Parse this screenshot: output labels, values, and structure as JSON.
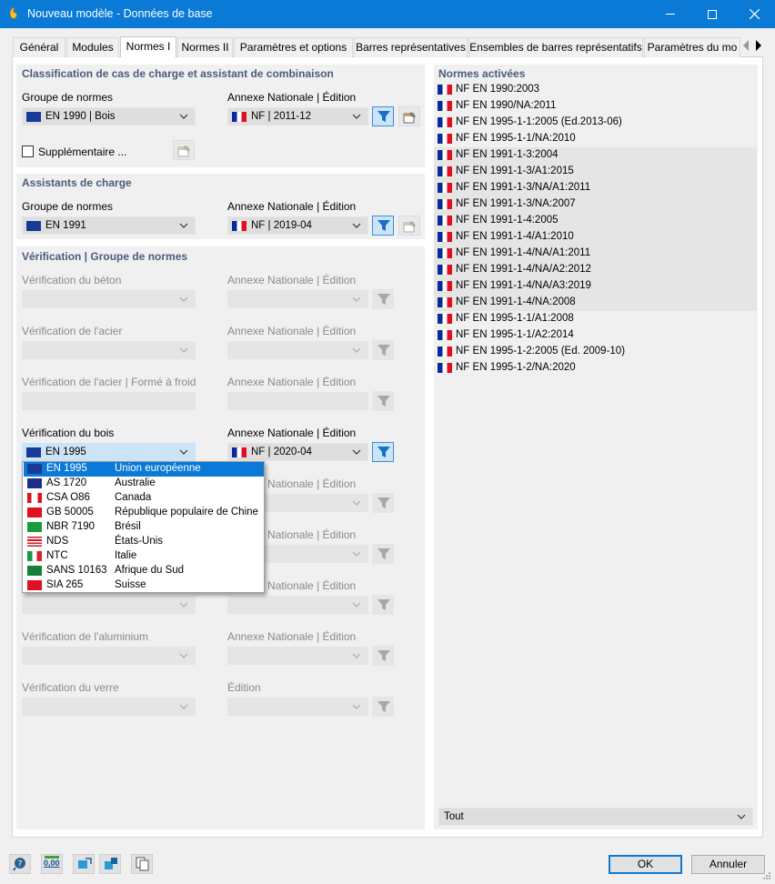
{
  "window": {
    "title": "Nouveau modèle - Données de base",
    "controls": {
      "minimize": "—",
      "maximize": "☐",
      "close": "✕"
    }
  },
  "tabs": [
    {
      "label": "Général"
    },
    {
      "label": "Modules"
    },
    {
      "label": "Normes I",
      "active": true
    },
    {
      "label": "Normes II"
    },
    {
      "label": "Paramètres et options"
    },
    {
      "label": "Barres représentatives"
    },
    {
      "label": "Ensembles de barres représentatifs"
    },
    {
      "label": "Paramètres du mo"
    }
  ],
  "classification": {
    "title": "Classification de cas de charge et assistant de combinaison",
    "group_label": "Groupe de normes",
    "group_value": "EN 1990 | Bois",
    "annex_label": "Annexe Nationale | Édition",
    "annex_value": "NF | 2011-12",
    "supplementary_label": "Supplémentaire ..."
  },
  "load_wizards": {
    "title": "Assistants de charge",
    "group_label": "Groupe de normes",
    "group_value": "EN 1991",
    "annex_label": "Annexe Nationale | Édition",
    "annex_value": "NF | 2019-04"
  },
  "verification": {
    "title": "Vérification | Groupe de normes",
    "annex_label": "Annexe Nationale | Édition",
    "edition_label": "Édition",
    "concrete_label": "Vérification du béton",
    "steel_label": "Vérification de l'acier",
    "coldformed_label": "Vérification de l'acier | Formé à froid",
    "timber_label": "Vérification du bois",
    "timber_value": "EN 1995",
    "timber_annex_value": "NF | 2020-04",
    "aluminium_label": "Vérification de l'aluminium",
    "glass_label": "Vérification du verre"
  },
  "timber_dropdown": [
    {
      "code": "EN 1995",
      "name": "Union européenne",
      "flag": "eu",
      "active": true
    },
    {
      "code": "AS 1720",
      "name": "Australie",
      "flag": "au"
    },
    {
      "code": "CSA O86",
      "name": "Canada",
      "flag": "ca"
    },
    {
      "code": "GB 50005",
      "name": "République populaire de Chine",
      "flag": "cn"
    },
    {
      "code": "NBR 7190",
      "name": "Brésil",
      "flag": "br"
    },
    {
      "code": "NDS",
      "name": "États-Unis",
      "flag": "us"
    },
    {
      "code": "NTC",
      "name": "Italie",
      "flag": "it"
    },
    {
      "code": "SANS 10163",
      "name": "Afrique du Sud",
      "flag": "za"
    },
    {
      "code": "SIA 265",
      "name": "Suisse",
      "flag": "ch"
    }
  ],
  "active_norms": {
    "title": "Normes activées",
    "items": [
      {
        "label": "NF EN 1990:2003"
      },
      {
        "label": "NF EN 1990/NA:2011"
      },
      {
        "label": "NF EN 1995-1-1:2005 (Ed.2013-06)"
      },
      {
        "label": "NF EN 1995-1-1/NA:2010"
      },
      {
        "label": "NF EN 1991-1-3:2004",
        "highlighted": true
      },
      {
        "label": "NF EN 1991-1-3/A1:2015",
        "highlighted": true
      },
      {
        "label": "NF EN 1991-1-3/NA/A1:2011",
        "highlighted": true
      },
      {
        "label": "NF EN 1991-1-3/NA:2007",
        "highlighted": true
      },
      {
        "label": "NF EN 1991-1-4:2005",
        "highlighted": true
      },
      {
        "label": "NF EN 1991-1-4/A1:2010",
        "highlighted": true
      },
      {
        "label": "NF EN 1991-1-4/NA/A1:2011",
        "highlighted": true
      },
      {
        "label": "NF EN 1991-1-4/NA/A2:2012",
        "highlighted": true
      },
      {
        "label": "NF EN 1991-1-4/NA/A3:2019",
        "highlighted": true
      },
      {
        "label": "NF EN 1991-1-4/NA:2008",
        "highlighted": true
      },
      {
        "label": "NF EN 1995-1-1/A1:2008"
      },
      {
        "label": "NF EN 1995-1-1/A2:2014"
      },
      {
        "label": "NF EN 1995-1-2:2005 (Ed. 2009-10)"
      },
      {
        "label": "NF EN 1995-1-2/NA:2020"
      }
    ],
    "filter_value": "Tout"
  },
  "footer": {
    "ok_label": "OK",
    "cancel_label": "Annuler",
    "units_label": "0,00"
  },
  "colors": {
    "accent": "#0a7ad6",
    "panel_title": "#4a5d7a",
    "selection": "#cce4f7"
  }
}
